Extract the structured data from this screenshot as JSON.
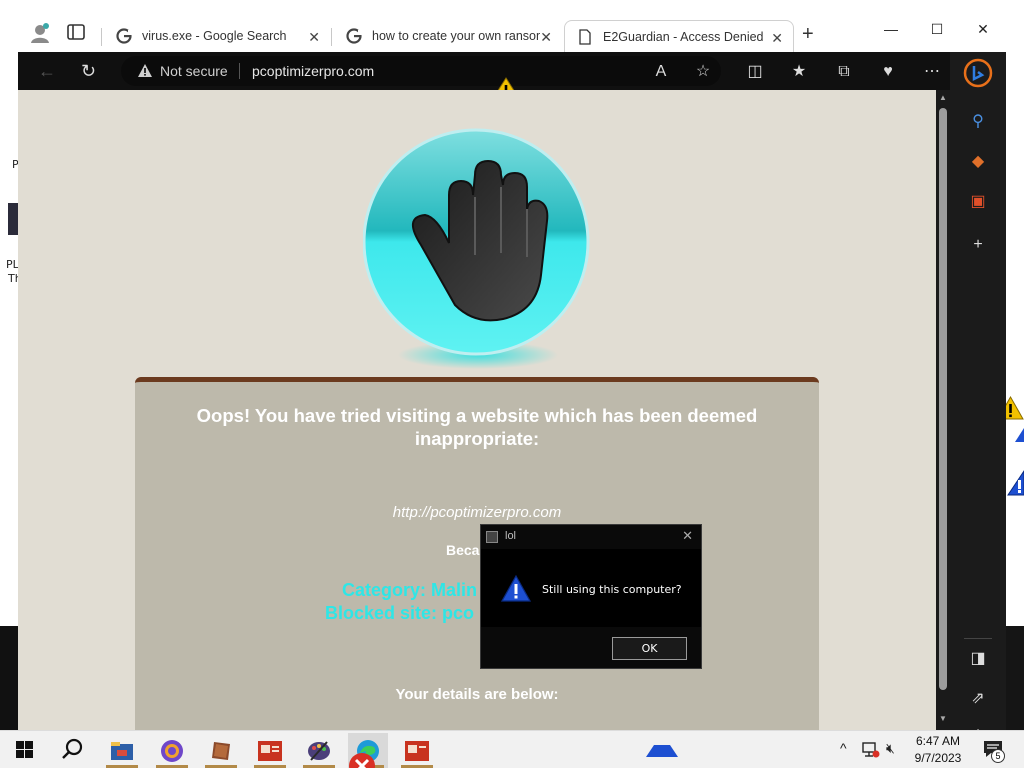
{
  "browser": {
    "tabs": [
      {
        "title": "virus.exe - Google Search",
        "active": false
      },
      {
        "title": "how to create your own ransom",
        "active": false
      },
      {
        "title": "E2Guardian - Access Denied",
        "active": true
      }
    ],
    "security_label": "Not secure",
    "url": "pcoptimizerpro.com"
  },
  "page": {
    "heading": "Oops! You have tried visiting a website which has been deemed inappropriate:",
    "blocked_url": "http://pcoptimizerpro.com",
    "because": "Beca",
    "category": "Category: Malin",
    "blocked_site": "Blocked site: pco",
    "details_heading": "Your details are below:"
  },
  "dialog": {
    "title": "lol",
    "message": "Still using this computer?",
    "ok_label": "OK"
  },
  "desktop": {
    "fragment_1": "P",
    "fragment_2": "PL",
    "fragment_3": "Th"
  },
  "taskbar": {
    "time": "6:47 AM",
    "date": "9/7/2023",
    "notification_count": "5"
  },
  "colors": {
    "page_bg": "#e1ddd3",
    "panel_bg": "#bdb9ab",
    "panel_border": "#6b3a1e",
    "category_text": "#2ee6e6",
    "logo_cyan": "#2ed8dc"
  }
}
